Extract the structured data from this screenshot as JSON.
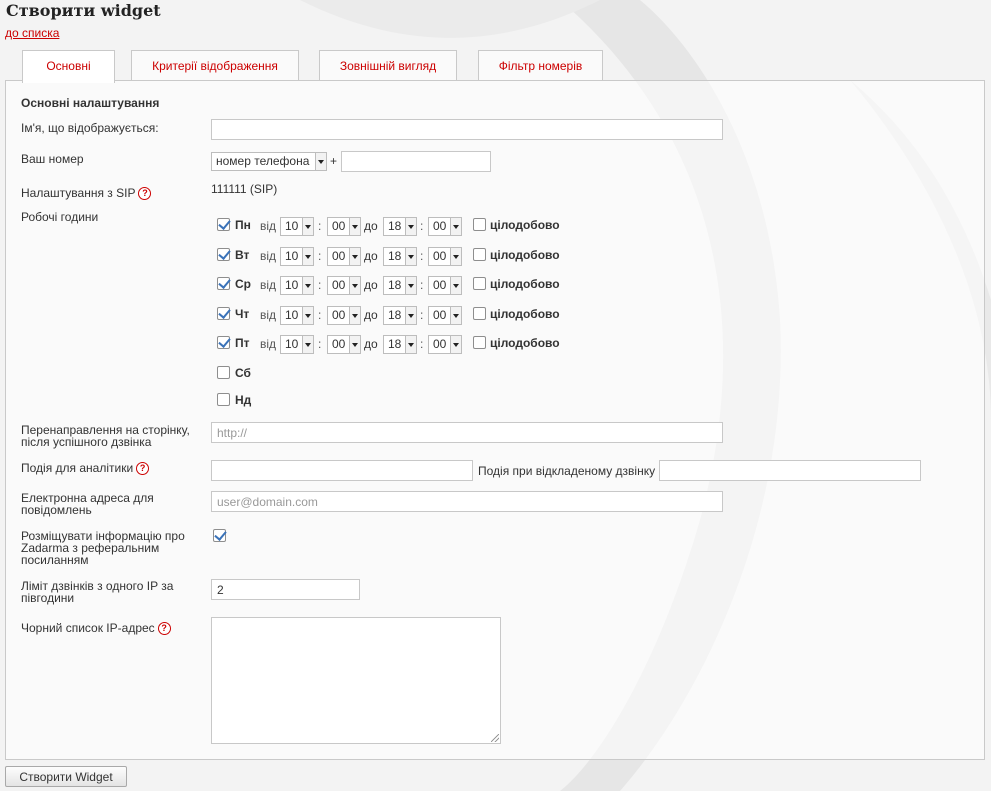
{
  "page": {
    "title": "Створити widget",
    "back_link": "до списка"
  },
  "tabs": [
    {
      "label": "Основні",
      "active": true
    },
    {
      "label": "Критерії відображення",
      "active": false
    },
    {
      "label": "Зовнішній вигляд",
      "active": false
    },
    {
      "label": "Фільтр номерів",
      "active": false
    }
  ],
  "form": {
    "section_title": "Основні налаштування",
    "display_name": {
      "label": "Ім'я, що відображується:",
      "value": ""
    },
    "your_number": {
      "label": "Ваш номер",
      "select_value": "номер телефона",
      "plus": "+",
      "value": ""
    },
    "sip": {
      "label": "Налаштування з SIP",
      "value": "111111 (SIP)"
    },
    "work_hours": {
      "label": "Робочі години",
      "from_label": "від",
      "to_label": "до",
      "colon": ":",
      "allday_label": "цілодобово",
      "days": [
        {
          "name": "Пн",
          "checked": true,
          "from_h": "10",
          "from_m": "00",
          "to_h": "18",
          "to_m": "00",
          "allday": false,
          "show_time": true
        },
        {
          "name": "Вт",
          "checked": true,
          "from_h": "10",
          "from_m": "00",
          "to_h": "18",
          "to_m": "00",
          "allday": false,
          "show_time": true
        },
        {
          "name": "Ср",
          "checked": true,
          "from_h": "10",
          "from_m": "00",
          "to_h": "18",
          "to_m": "00",
          "allday": false,
          "show_time": true
        },
        {
          "name": "Чт",
          "checked": true,
          "from_h": "10",
          "from_m": "00",
          "to_h": "18",
          "to_m": "00",
          "allday": false,
          "show_time": true
        },
        {
          "name": "Пт",
          "checked": true,
          "from_h": "10",
          "from_m": "00",
          "to_h": "18",
          "to_m": "00",
          "allday": false,
          "show_time": true
        },
        {
          "name": "Сб",
          "checked": false,
          "show_time": false
        },
        {
          "name": "Нд",
          "checked": false,
          "show_time": false
        }
      ]
    },
    "redirect": {
      "label_line1": "Перенаправлення на сторінку,",
      "label_line2": "після успішного дзвінка",
      "placeholder": "http://",
      "value": ""
    },
    "analytics": {
      "label": "Подія для аналітики",
      "value": "",
      "deferred_label": "Подія при відкладеному дзвінку",
      "deferred_value": ""
    },
    "email": {
      "label_line1": "Електронна адреса для",
      "label_line2": "повідомлень",
      "placeholder": "user@domain.com",
      "value": ""
    },
    "referral": {
      "label_line1": "Розміщувати інформацію про",
      "label_line2": "Zadarma з реферальним",
      "label_line3": "посиланням",
      "checked": true
    },
    "ip_limit": {
      "label_line1": "Ліміт дзвінків з одного IP за",
      "label_line2": "півгодини",
      "value": "2"
    },
    "blacklist": {
      "label": "Чорний список IP-адрес",
      "value": ""
    }
  },
  "submit": {
    "label": "Створити Widget"
  },
  "icons": {
    "help": "question-circle-icon",
    "dropdown": "triangle-down-icon",
    "check": "checkmark-icon"
  },
  "colors": {
    "accent": "#cc0000",
    "check": "#3b73b9",
    "border": "#c9c9c9"
  }
}
